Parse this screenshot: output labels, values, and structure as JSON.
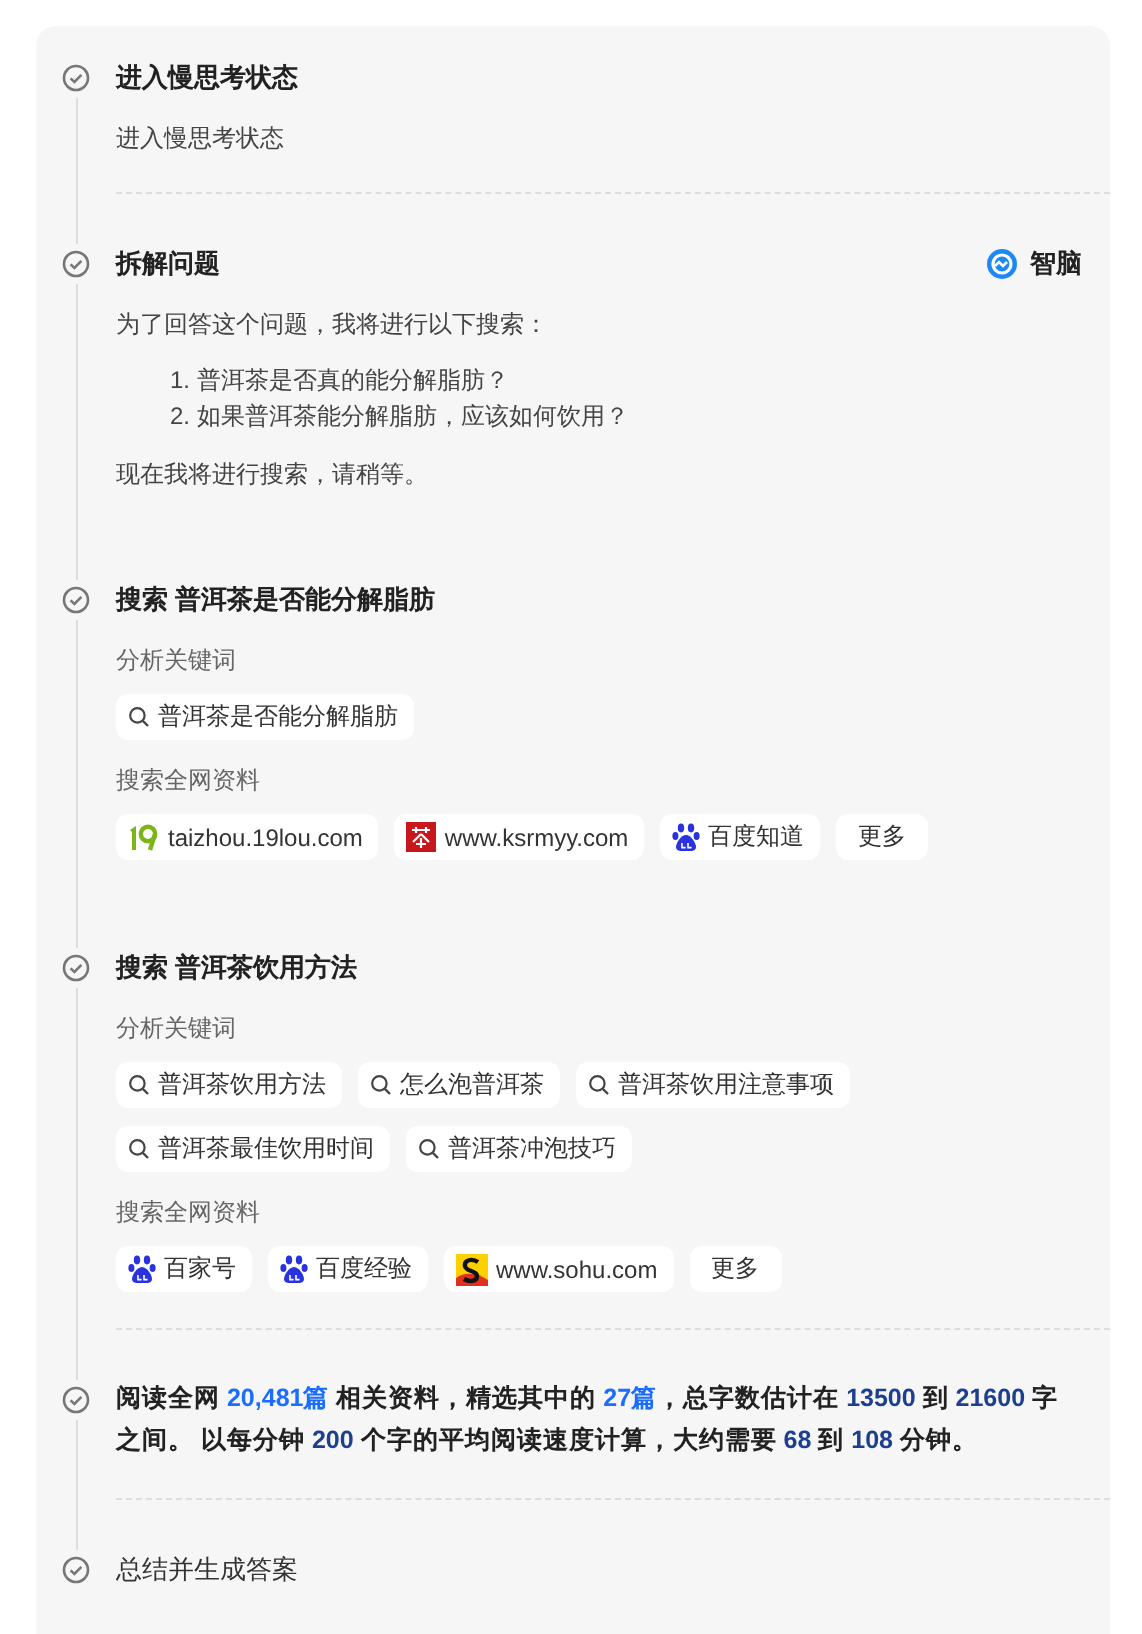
{
  "steps": [
    {
      "kind": "text",
      "title": "进入慢思考状态",
      "body": "进入慢思考状态",
      "divider": true
    },
    {
      "kind": "plan",
      "title": "拆解问题",
      "badge": "智脑",
      "intro": "为了回答这个问题，我将进行以下搜索：",
      "items": [
        "1. 普洱茶是否真的能分解脂肪？",
        "2. 如果普洱茶能分解脂肪，应该如何饮用？"
      ],
      "outro": "现在我将进行搜索，请稍等。",
      "divider": false
    },
    {
      "kind": "search",
      "title": "搜索 普洱茶是否能分解脂肪",
      "keywords_label": "分析关键词",
      "keywords": [
        "普洱茶是否能分解脂肪"
      ],
      "sources_label": "搜索全网资料",
      "sources": [
        {
          "kind": "nineteen",
          "name": "taizhou.19lou.com"
        },
        {
          "kind": "tea",
          "name": "www.ksrmyy.com"
        },
        {
          "kind": "paw",
          "name": "百度知道"
        }
      ],
      "more": "更多",
      "divider": false
    },
    {
      "kind": "search",
      "title": "搜索 普洱茶饮用方法",
      "keywords_label": "分析关键词",
      "keywords": [
        "普洱茶饮用方法",
        "怎么泡普洱茶",
        "普洱茶饮用注意事项",
        "普洱茶最佳饮用时间",
        "普洱茶冲泡技巧"
      ],
      "sources_label": "搜索全网资料",
      "sources": [
        {
          "kind": "paw",
          "name": "百家号"
        },
        {
          "kind": "paw",
          "name": "百度经验"
        },
        {
          "kind": "sohu",
          "name": "www.sohu.com"
        }
      ],
      "more": "更多",
      "divider": true
    },
    {
      "kind": "summary",
      "segments": [
        {
          "kind": "text",
          "text": "阅读全网 "
        },
        {
          "kind": "link",
          "text": "20,481篇"
        },
        {
          "kind": "text",
          "text": " 相关资料，精选其中的 "
        },
        {
          "kind": "link",
          "text": "27篇"
        },
        {
          "kind": "text",
          "text": "，总字数估计在 "
        },
        {
          "kind": "number",
          "text": "13500"
        },
        {
          "kind": "text",
          "text": " 到 "
        },
        {
          "kind": "number",
          "text": "21600"
        },
        {
          "kind": "text",
          "text": " 字之间。 以每分钟 "
        },
        {
          "kind": "number",
          "text": "200"
        },
        {
          "kind": "text",
          "text": " 个字的平均阅读速度计算，大约需要 "
        },
        {
          "kind": "number",
          "text": "68"
        },
        {
          "kind": "text",
          "text": " 到 "
        },
        {
          "kind": "number",
          "text": "108"
        },
        {
          "kind": "text",
          "text": " 分钟。"
        }
      ],
      "divider": true
    },
    {
      "kind": "final",
      "title": "总结并生成答案",
      "divider": false
    }
  ]
}
